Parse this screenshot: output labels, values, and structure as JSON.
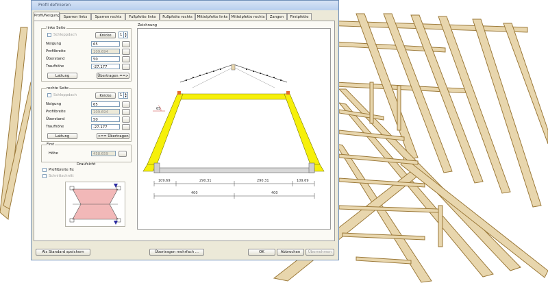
{
  "window": {
    "title": "Profil definieren"
  },
  "tabs": [
    "Profil/Neigung",
    "Sparren links",
    "Sparren rechts",
    "Fußpfette links",
    "Fußpfette rechts",
    "Mittelpfette links",
    "Mittelpfette rechts",
    "Zangen",
    "Firstpfette"
  ],
  "left_side": {
    "title": "linke Seite",
    "schlepp_label": "Schleppdach",
    "knick_button": "Knicke",
    "knick_value": "1",
    "rows": [
      {
        "label": "Neigung",
        "value": "65"
      },
      {
        "label": "Profilbreite",
        "value": "109.694"
      },
      {
        "label": "Überstand",
        "value": "50"
      },
      {
        "label": "Traufhöhe",
        "value": "-27.177"
      }
    ],
    "lattung_button": "Lattung",
    "transfer_button": "Übertragen ==>"
  },
  "right_side": {
    "title": "rechte Seite",
    "schlepp_label": "Schleppdach",
    "knick_button": "Knicke",
    "knick_value": "1",
    "rows": [
      {
        "label": "Neigung",
        "value": "65"
      },
      {
        "label": "Profilbreite",
        "value": "109.694"
      },
      {
        "label": "Überstand",
        "value": "50"
      },
      {
        "label": "Traufhöhe",
        "value": "-27.177"
      }
    ],
    "lattung_button": "Lattung",
    "transfer_button": "<== Übertragen"
  },
  "first": {
    "title": "First",
    "hoehe_label": "Höhe",
    "hoehe_value": "458.659"
  },
  "draufsicht": {
    "title": "Draufsicht",
    "profilbreite_fix": "Profilbreite fix",
    "schnittschnitt": "Schnittschnitt"
  },
  "drawing": {
    "title": "Zeichnung",
    "angle": "65",
    "dims_top": [
      "109.69",
      "290.31",
      "290.31",
      "109.69"
    ],
    "dims_bottom": [
      "400",
      "400"
    ]
  },
  "footer": {
    "standard_button": "Als Standard speichern",
    "transfer_multi_button": "Übertragen mehrfach ...",
    "ok_button": "OK",
    "cancel_button": "Abbrechen",
    "apply_button": "Übernehmen"
  },
  "colors": {
    "timber": "#e5d3a9",
    "timber_edge": "#9c7a3a",
    "profile": "#f6f00a",
    "accent": "#e36b2f",
    "dialog": "#ece9d8"
  }
}
